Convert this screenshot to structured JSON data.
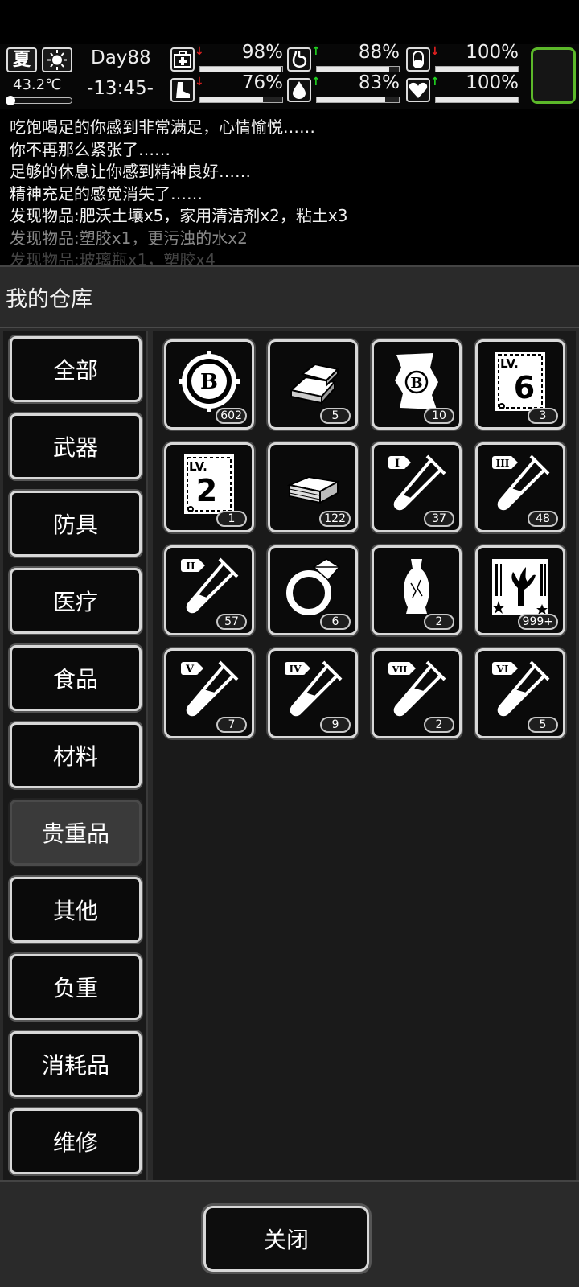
{
  "status": {
    "season": "夏",
    "weather_icon": "sun-icon",
    "temperature": "43.2℃",
    "day": "Day88",
    "time": "-13:45-",
    "temperature_level": 0.1,
    "stats": [
      {
        "id": "health",
        "icon": "medkit-icon",
        "trend": "down",
        "value": "98%",
        "level": 0.98
      },
      {
        "id": "hunger",
        "icon": "stomach-icon",
        "trend": "up",
        "value": "88%",
        "level": 0.88
      },
      {
        "id": "medicine",
        "icon": "pill-icon",
        "trend": "down",
        "value": "100%",
        "level": 1.0
      },
      {
        "id": "stamina",
        "icon": "boot-icon",
        "trend": "down",
        "value": "76%",
        "level": 0.76
      },
      {
        "id": "thirst",
        "icon": "water-drop-icon",
        "trend": "up",
        "value": "83%",
        "level": 0.83
      },
      {
        "id": "mood",
        "icon": "heart-icon",
        "trend": "up",
        "value": "100%",
        "level": 1.0
      }
    ]
  },
  "log": [
    "吃饱喝足的你感到非常满足，心情愉悦……",
    "你不再那么紧张了……",
    "足够的休息让你感到精神良好……",
    "精神充足的感觉消失了……",
    "发现物品:肥沃土壤x5，家用清洁剂x2，粘土x3",
    "发现物品:塑胶x1，更污浊的水x2",
    "发现物品:玻璃瓶x1，塑胶x4"
  ],
  "storage": {
    "title": "我的仓库",
    "categories": [
      "全部",
      "武器",
      "防具",
      "医疗",
      "食品",
      "材料",
      "贵重品",
      "其他",
      "负重",
      "消耗品",
      "维修"
    ],
    "active_category": "贵重品",
    "items": [
      {
        "icon": "bitcoin-coin-icon",
        "count": "602"
      },
      {
        "icon": "gold-bars-icon",
        "count": "5"
      },
      {
        "icon": "bitcoin-map-icon",
        "count": "10"
      },
      {
        "icon": "skill-book-lv6-icon",
        "count": "3"
      },
      {
        "icon": "skill-book-lv2-icon",
        "count": "1"
      },
      {
        "icon": "cash-stack-icon",
        "count": "122"
      },
      {
        "icon": "test-tube-1-icon",
        "count": "37"
      },
      {
        "icon": "test-tube-3-icon",
        "count": "48"
      },
      {
        "icon": "test-tube-2-icon",
        "count": "57"
      },
      {
        "icon": "diamond-ring-icon",
        "count": "6"
      },
      {
        "icon": "antique-vase-icon",
        "count": "2"
      },
      {
        "icon": "coral-card-icon",
        "count": "999+"
      },
      {
        "icon": "test-tube-5-icon",
        "count": "7"
      },
      {
        "icon": "test-tube-4-icon",
        "count": "9"
      },
      {
        "icon": "test-tube-7-icon",
        "count": "2"
      },
      {
        "icon": "test-tube-6-icon",
        "count": "5"
      }
    ],
    "book_levels": {
      "lv6": "6",
      "lv2": "2",
      "lv_prefix": "LV."
    },
    "tube_labels": {
      "t1": "I",
      "t2": "II",
      "t3": "III",
      "t4": "IV",
      "t5": "V",
      "t6": "VI",
      "t7": "VII"
    },
    "coin_letter": "B",
    "close_label": "关闭"
  }
}
